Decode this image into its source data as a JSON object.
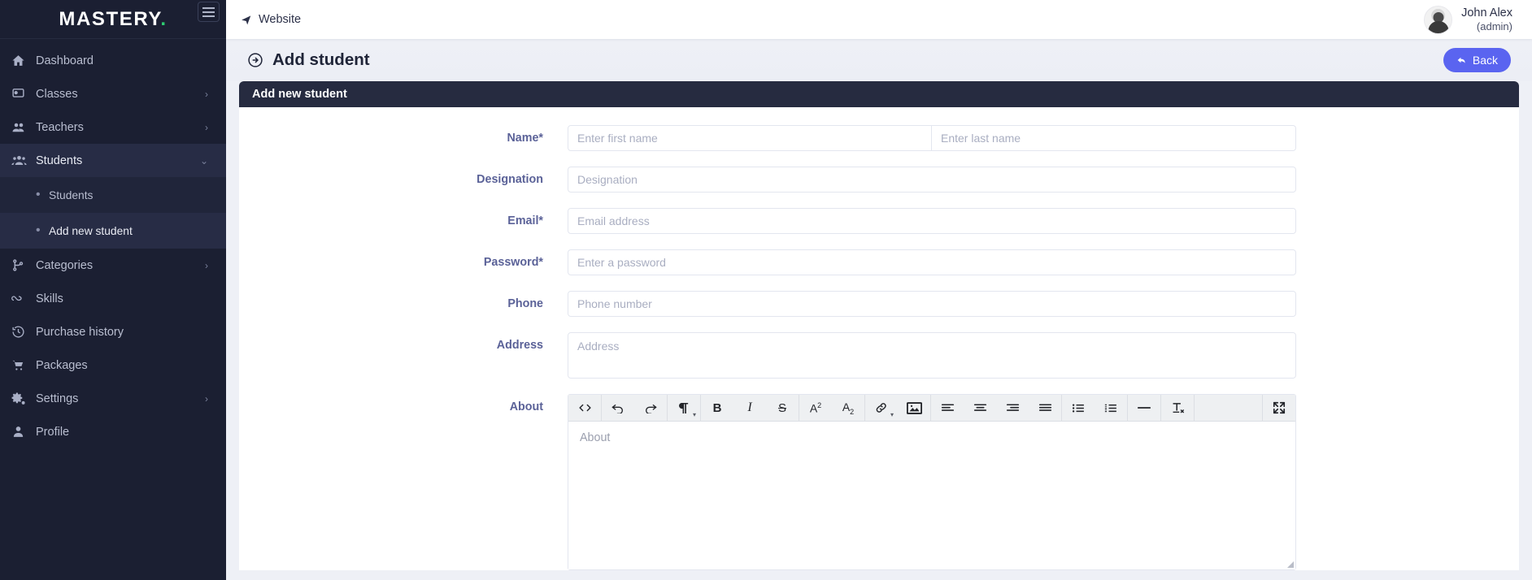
{
  "sidebar": {
    "brand": "MASTERY",
    "brand_dot": ".",
    "menu_icon": "hamburger-icon",
    "items": [
      {
        "label": "Dashboard",
        "icon": "home-icon",
        "caret": "",
        "active": false
      },
      {
        "label": "Classes",
        "icon": "classes-icon",
        "caret": "›",
        "active": false
      },
      {
        "label": "Teachers",
        "icon": "teachers-icon",
        "caret": "›",
        "active": false
      },
      {
        "label": "Students",
        "icon": "students-icon",
        "caret": "⌄",
        "active": true
      },
      {
        "label": "Categories",
        "icon": "categories-icon",
        "caret": "›",
        "active": false
      },
      {
        "label": "Skills",
        "icon": "skills-icon",
        "caret": "",
        "active": false
      },
      {
        "label": "Purchase history",
        "icon": "history-icon",
        "caret": "",
        "active": false
      },
      {
        "label": "Packages",
        "icon": "cart-icon",
        "caret": "",
        "active": false
      },
      {
        "label": "Settings",
        "icon": "gear-icon",
        "caret": "›",
        "active": false
      },
      {
        "label": "Profile",
        "icon": "user-icon",
        "caret": "",
        "active": false
      }
    ],
    "submenu": [
      {
        "label": "Students",
        "selected": false
      },
      {
        "label": "Add new student",
        "selected": true
      }
    ]
  },
  "topbar": {
    "website_label": "Website",
    "website_icon": "paper-plane-icon",
    "user_name": "John Alex",
    "user_role": "(admin)",
    "avatar": "avatar"
  },
  "page": {
    "title": "Add student",
    "title_icon": "arrow-circle-right-icon",
    "back_label": "Back",
    "back_icon": "arrow-back-icon",
    "back_color": "#5a64f0"
  },
  "card": {
    "header": "Add new student",
    "header_bg": "#262b40",
    "fields": [
      {
        "label": "Name*",
        "name": "name",
        "type": "split",
        "placeholder_first": "Enter first name",
        "placeholder_last": "Enter last name",
        "value": ""
      },
      {
        "label": "Designation",
        "name": "designation",
        "type": "text",
        "placeholder": "Designation",
        "value": ""
      },
      {
        "label": "Email*",
        "name": "email",
        "type": "text",
        "placeholder": "Email address",
        "value": ""
      },
      {
        "label": "Password*",
        "name": "password",
        "type": "password",
        "placeholder": "Enter a password",
        "value": ""
      },
      {
        "label": "Phone",
        "name": "phone",
        "type": "text",
        "placeholder": "Phone number",
        "value": ""
      },
      {
        "label": "Address",
        "name": "address",
        "type": "textarea",
        "placeholder": "Address",
        "value": ""
      }
    ],
    "about": {
      "label": "About",
      "placeholder": "About",
      "toolbar_groups": [
        [
          {
            "icon": "source-code-icon",
            "glyph": "<>"
          }
        ],
        [
          {
            "icon": "undo-icon",
            "glyph": "↶"
          },
          {
            "icon": "redo-icon",
            "glyph": "↷"
          }
        ],
        [
          {
            "icon": "paragraph-format-icon",
            "glyph": "¶"
          }
        ],
        [
          {
            "icon": "bold-icon",
            "glyph": "B"
          },
          {
            "icon": "italic-icon",
            "glyph": "I"
          },
          {
            "icon": "strikethrough-icon",
            "glyph": "S"
          }
        ],
        [
          {
            "icon": "superscript-icon",
            "glyph": "A²"
          },
          {
            "icon": "subscript-icon",
            "glyph": "A₂"
          }
        ],
        [
          {
            "icon": "link-icon",
            "glyph": "🔗"
          },
          {
            "icon": "insert-image-icon",
            "glyph": "▣"
          }
        ],
        [
          {
            "icon": "align-left-icon",
            "glyph": "≡"
          },
          {
            "icon": "align-center-icon",
            "glyph": "≡"
          },
          {
            "icon": "align-right-icon",
            "glyph": "≡"
          },
          {
            "icon": "align-justify-icon",
            "glyph": "≡"
          }
        ],
        [
          {
            "icon": "unordered-list-icon",
            "glyph": "☰"
          },
          {
            "icon": "ordered-list-icon",
            "glyph": "☰"
          }
        ],
        [
          {
            "icon": "horizontal-rule-icon",
            "glyph": "—"
          }
        ],
        [
          {
            "icon": "remove-format-icon",
            "glyph": "Tₓ"
          }
        ],
        [
          {
            "icon": "fullscreen-icon",
            "glyph": "⤢"
          }
        ]
      ]
    }
  }
}
